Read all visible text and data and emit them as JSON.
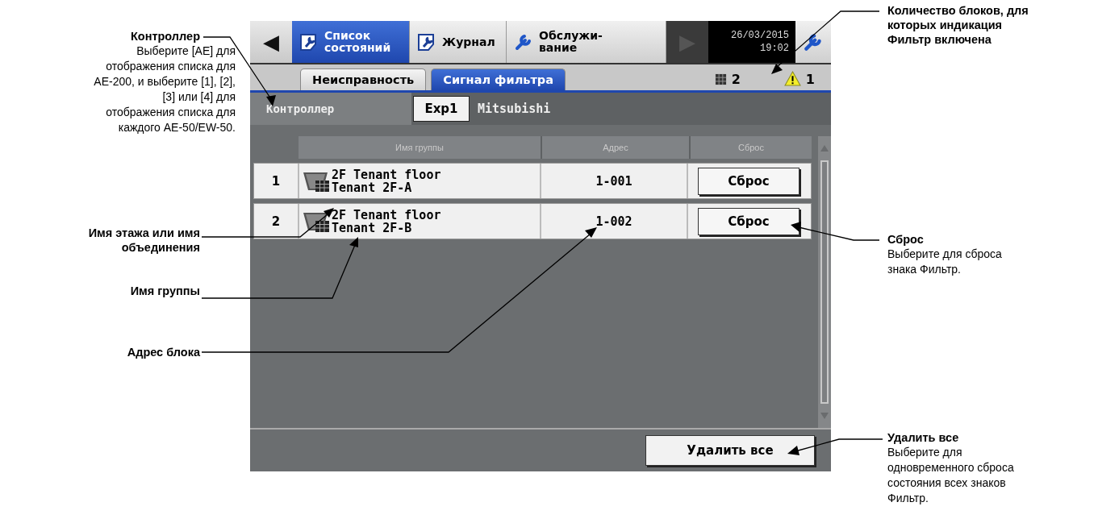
{
  "left_notes": [
    {
      "title": "Контроллер",
      "text": "Выберите [AE] для отображения списка для AE-200, и выберите [1], [2], [3] или [4] для отображения списка для каждого AE-50/EW-50."
    },
    {
      "title": "Имя этажа или имя объединения"
    },
    {
      "title": "Имя группы"
    },
    {
      "title": "Адрес блока"
    }
  ],
  "screen": {
    "nav": [
      {
        "kind": "arrow",
        "glyph": "◀",
        "disabled": false
      },
      {
        "kind": "tab",
        "lines": [
          "Список",
          "состояний"
        ],
        "selected": true
      },
      {
        "kind": "tab",
        "lines": [
          "Журнал"
        ],
        "selected": false
      },
      {
        "kind": "tab",
        "lines": [
          "Обслужи-",
          "вание"
        ],
        "selected": false
      },
      {
        "kind": "arrow",
        "glyph": "▶",
        "disabled": true
      },
      {
        "kind": "clock",
        "date": "26/03/2015",
        "time": "19:02"
      },
      {
        "kind": "settings"
      }
    ],
    "subtabs": [
      {
        "label": "Неисправность",
        "selected": false
      },
      {
        "label": "Сигнал фильтра",
        "selected": true
      }
    ],
    "filter_count": "2",
    "alarm_count": "1",
    "controller": {
      "label": "Контроллер",
      "button": "Exp1",
      "name": "Mitsubishi"
    },
    "table": {
      "columns": [
        "Имя группы",
        "Адрес",
        "Сброс"
      ],
      "rows": [
        {
          "number": "1",
          "floor": "2F Tenant floor",
          "group": "Tenant 2F-A",
          "address": "1-001",
          "button": "Сброс"
        },
        {
          "number": "2",
          "floor": "2F Tenant floor",
          "group": "Tenant 2F-B",
          "address": "1-002",
          "button": "Сброс"
        }
      ]
    },
    "delete_all_button": "Удалить все"
  },
  "right_notes": [
    {
      "title": "Количество блоков, для которых индикация Фильтр включена"
    },
    {
      "title": "Сброс",
      "text": "Выберите для сброса знака Фильтр."
    },
    {
      "title": "Удалить все",
      "text": "Выберите для одновременного сброса состояния всех знаков Фильтр."
    }
  ]
}
